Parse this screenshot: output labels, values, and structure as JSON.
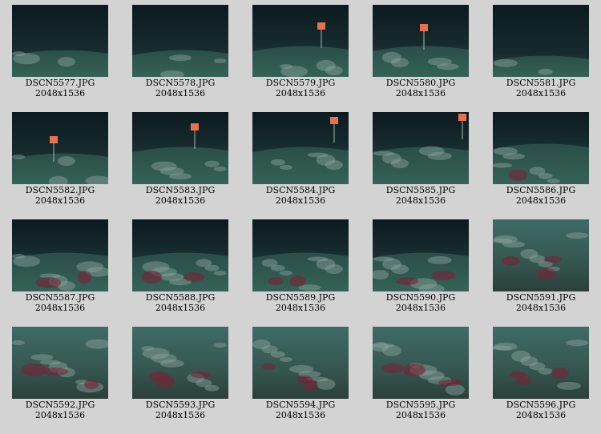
{
  "gallery": {
    "thumbnails": [
      {
        "filename": "DSCN5577.JPG",
        "dimensions": "2048x1536",
        "scene": "whale-bones-far",
        "marker": false
      },
      {
        "filename": "DSCN5578.JPG",
        "dimensions": "2048x1536",
        "scene": "whale-bones-far",
        "marker": false
      },
      {
        "filename": "DSCN5579.JPG",
        "dimensions": "2048x1536",
        "scene": "marker-pole",
        "marker": true
      },
      {
        "filename": "DSCN5580.JPG",
        "dimensions": "2048x1536",
        "scene": "marker-pole",
        "marker": true
      },
      {
        "filename": "DSCN5581.JPG",
        "dimensions": "2048x1536",
        "scene": "dark-seafloor",
        "marker": false
      },
      {
        "filename": "DSCN5582.JPG",
        "dimensions": "2048x1536",
        "scene": "marker-pole",
        "marker": true
      },
      {
        "filename": "DSCN5583.JPG",
        "dimensions": "2048x1536",
        "scene": "marker-pole-close",
        "marker": true
      },
      {
        "filename": "DSCN5584.JPG",
        "dimensions": "2048x1536",
        "scene": "marker-pole-close",
        "marker": true
      },
      {
        "filename": "DSCN5585.JPG",
        "dimensions": "2048x1536",
        "scene": "marker-pole-close",
        "marker": true
      },
      {
        "filename": "DSCN5586.JPG",
        "dimensions": "2048x1536",
        "scene": "bone-pile",
        "marker": false
      },
      {
        "filename": "DSCN5587.JPG",
        "dimensions": "2048x1536",
        "scene": "bone-field-red",
        "marker": false
      },
      {
        "filename": "DSCN5588.JPG",
        "dimensions": "2048x1536",
        "scene": "bone-field-red",
        "marker": false
      },
      {
        "filename": "DSCN5589.JPG",
        "dimensions": "2048x1536",
        "scene": "bone-field-red",
        "marker": false
      },
      {
        "filename": "DSCN5590.JPG",
        "dimensions": "2048x1536",
        "scene": "bone-field-red",
        "marker": false
      },
      {
        "filename": "DSCN5591.JPG",
        "dimensions": "2048x1536",
        "scene": "bone-closeup",
        "marker": false
      },
      {
        "filename": "DSCN5592.JPG",
        "dimensions": "2048x1536",
        "scene": "bone-closeup",
        "marker": false
      },
      {
        "filename": "DSCN5593.JPG",
        "dimensions": "2048x1536",
        "scene": "bone-closeup",
        "marker": false
      },
      {
        "filename": "DSCN5594.JPG",
        "dimensions": "2048x1536",
        "scene": "bone-closeup",
        "marker": false
      },
      {
        "filename": "DSCN5595.JPG",
        "dimensions": "2048x1536",
        "scene": "bone-closeup",
        "marker": false
      },
      {
        "filename": "DSCN5596.JPG",
        "dimensions": "2048x1536",
        "scene": "bone-closeup",
        "marker": false
      }
    ]
  },
  "colors": {
    "page_background": "#d3d3d3",
    "deep_water": "#0b1a1e",
    "seafloor": "#2f5a4f",
    "bone": "#8fa6a0",
    "red_mat": "#7a2238",
    "marker": "#e8704a"
  }
}
